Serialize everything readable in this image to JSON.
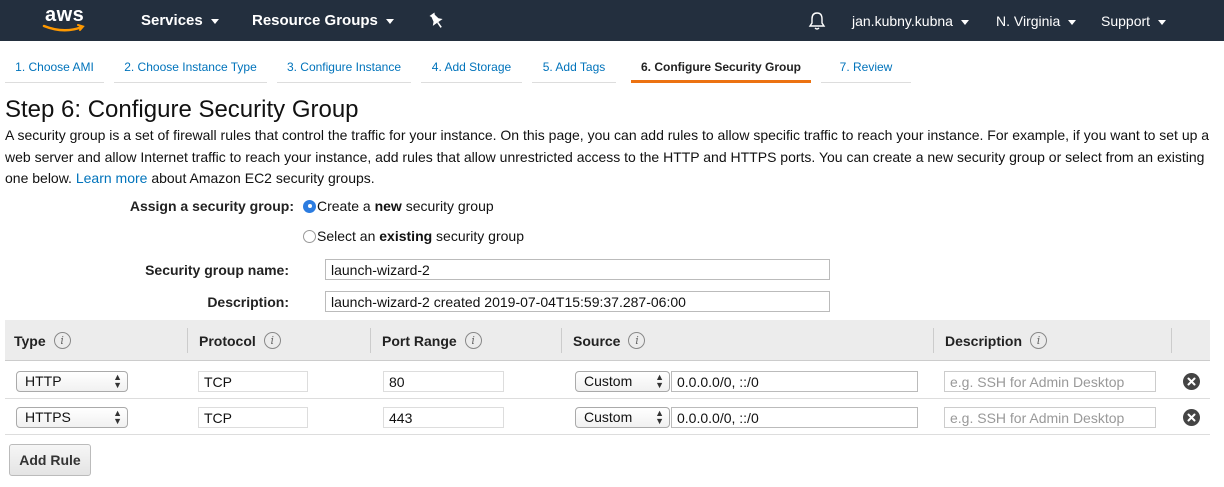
{
  "nav": {
    "logo": "aws",
    "services": "Services",
    "resource_groups": "Resource Groups",
    "user": "jan.kubny.kubna",
    "region": "N. Virginia",
    "support": "Support",
    "background": "#232f3e"
  },
  "wizard_tabs": [
    {
      "label": "1. Choose AMI"
    },
    {
      "label": "2. Choose Instance Type"
    },
    {
      "label": "3. Configure Instance"
    },
    {
      "label": "4. Add Storage"
    },
    {
      "label": "5. Add Tags"
    },
    {
      "label": "6. Configure Security Group",
      "active": true
    },
    {
      "label": "7. Review"
    }
  ],
  "page": {
    "title": "Step 6: Configure Security Group",
    "desc_part1": "A security group is a set of firewall rules that control the traffic for your instance. On this page, you can add rules to allow specific traffic to reach your instance. For example, if you want to set up a web server and allow Internet traffic to reach your instance, add rules that allow unrestricted access to the HTTP and HTTPS ports. You can create a new security group or select from an existing one below.",
    "learn_more": "Learn more",
    "desc_part2": "about Amazon EC2 security groups."
  },
  "form": {
    "assign_label": "Assign a security group:",
    "option_new": {
      "pre": "Create a ",
      "bold": "new",
      "post": " security group",
      "selected": true
    },
    "option_existing": {
      "pre": "Select an ",
      "bold": "existing",
      "post": " security group",
      "selected": false
    },
    "name_label": "Security group name:",
    "name_value": "launch-wizard-2",
    "desc_label": "Description:",
    "desc_value": "launch-wizard-2 created 2019-07-04T15:59:37.287-06:00"
  },
  "table": {
    "headers": {
      "type": "Type",
      "protocol": "Protocol",
      "port_range": "Port Range",
      "source": "Source",
      "description": "Description"
    },
    "info_glyph": "i",
    "rows": [
      {
        "type": "HTTP",
        "protocol": "TCP",
        "port": "80",
        "source_type": "Custom",
        "source": "0.0.0.0/0, ::/0",
        "description_placeholder": "e.g. SSH for Admin Desktop"
      },
      {
        "type": "HTTPS",
        "protocol": "TCP",
        "port": "443",
        "source_type": "Custom",
        "source": "0.0.0.0/0, ::/0",
        "description_placeholder": "e.g. SSH for Admin Desktop"
      }
    ]
  },
  "add_rule_button": "Add Rule",
  "colors": {
    "link": "#0073bb",
    "active_tab_underline": "#ec7211",
    "radio_selected": "#2c7ce0"
  }
}
